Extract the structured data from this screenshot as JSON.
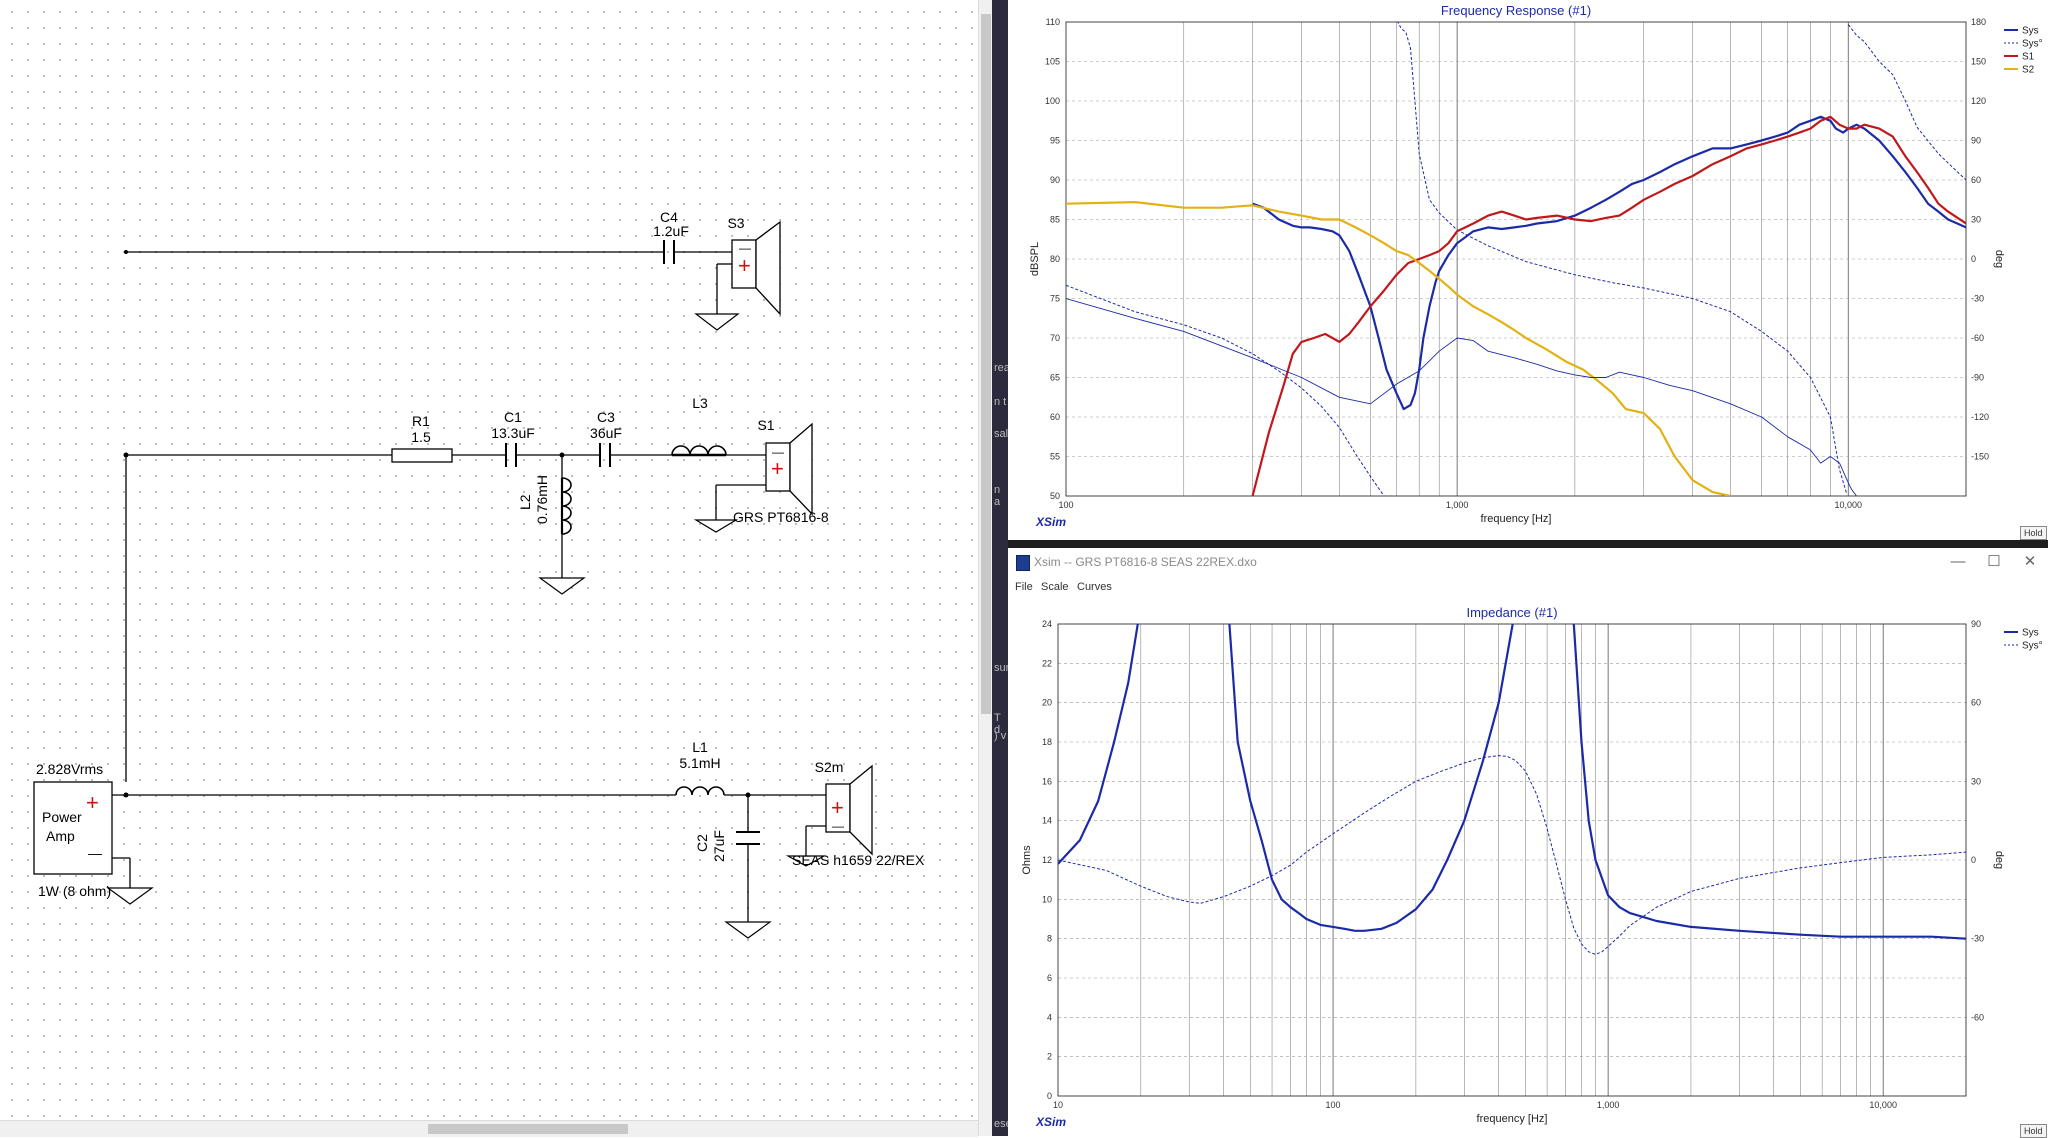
{
  "schematic": {
    "components": {
      "c4": {
        "name": "C4",
        "value": "1.2uF"
      },
      "s3": {
        "name": "S3"
      },
      "r1": {
        "name": "R1",
        "value": "1.5"
      },
      "c1": {
        "name": "C1",
        "value": "13.3uF"
      },
      "c3": {
        "name": "C3",
        "value": "36uF"
      },
      "l3": {
        "name": "L3"
      },
      "s1": {
        "name": "S1",
        "driver": "GRS PT6816-8"
      },
      "l2": {
        "name": "L2",
        "value": "0.76mH"
      },
      "l1": {
        "name": "L1",
        "value": "5.1mH"
      },
      "c2": {
        "name": "C2",
        "value": "27uF"
      },
      "s2m": {
        "name": "S2m",
        "driver": "SEAS h1659 22/REX"
      },
      "amp": {
        "voltage": "2.828Vrms",
        "line1": "Power",
        "line2": "Amp",
        "rating": "1W (8 ohm)"
      }
    },
    "plus_sign": "+",
    "minus_sign": "—"
  },
  "gap_fragments": [
    "rea",
    "n t",
    "sal",
    "n a",
    "sur",
    "T d",
    ") v",
    "ese"
  ],
  "fr_window": {
    "brand": "XSim",
    "hold_label": "Hold"
  },
  "imp_window": {
    "title": "Xsim -- GRS PT6816-8 SEAS 22REX.dxo",
    "menu": [
      "File",
      "Scale",
      "Curves"
    ],
    "brand": "XSim",
    "hold_label": "Hold",
    "minimize": "—",
    "maximize": "☐",
    "close": "✕"
  },
  "chart_data": [
    {
      "type": "line",
      "title": "Frequency Response (#1)",
      "xlabel": "frequency [Hz]",
      "ylabel": "dBSPL",
      "y2label": "deg",
      "xscale": "log",
      "xlim": [
        100,
        20000
      ],
      "ylim": [
        50,
        110
      ],
      "y2lim": [
        -180,
        180
      ],
      "xticks": [
        100,
        1000,
        10000
      ],
      "xtick_labels": [
        "100",
        "1,000",
        "10,000"
      ],
      "yticks": [
        50,
        55,
        60,
        65,
        70,
        75,
        80,
        85,
        90,
        95,
        100,
        105,
        110
      ],
      "y2ticks": [
        -150,
        -120,
        -90,
        -60,
        -30,
        0,
        30,
        60,
        90,
        120,
        150,
        180
      ],
      "grid": true,
      "legend_position": "top-right",
      "series": [
        {
          "name": "Sys",
          "color": "#1b2ba8",
          "width": 2.2,
          "dash": false,
          "axis": "y",
          "x": [
            300,
            320,
            350,
            380,
            400,
            420,
            450,
            480,
            500,
            530,
            560,
            600,
            630,
            660,
            700,
            730,
            760,
            780,
            800,
            820,
            850,
            880,
            900,
            950,
            1000,
            1100,
            1200,
            1300,
            1400,
            1500,
            1600,
            1800,
            2000,
            2200,
            2400,
            2600,
            2800,
            3000,
            3300,
            3600,
            4000,
            4500,
            5000,
            5500,
            6000,
            6500,
            7000,
            7500,
            8000,
            8500,
            9000,
            9300,
            9700,
            10000,
            10500,
            11000,
            12000,
            13000,
            14000,
            15000,
            16000,
            17000,
            18000,
            19000,
            20000
          ],
          "y": [
            87,
            86.5,
            85,
            84.2,
            84,
            84,
            83.8,
            83.5,
            83,
            81,
            78,
            74,
            70,
            66,
            63,
            61,
            61.5,
            63,
            66,
            70,
            74,
            77,
            78.5,
            80.5,
            82,
            83.5,
            84,
            83.8,
            84,
            84.2,
            84.5,
            84.8,
            85.5,
            86.5,
            87.5,
            88.5,
            89.5,
            90,
            91,
            92,
            93,
            94,
            94,
            94.5,
            95,
            95.5,
            96,
            97,
            97.5,
            98,
            97.5,
            96.5,
            96,
            96.5,
            97,
            96.5,
            95,
            93,
            91,
            89,
            87,
            86,
            85,
            84.5,
            84
          ]
        },
        {
          "name": "Sys°",
          "color": "#1b2ba8",
          "width": 1,
          "dash": true,
          "axis": "y2",
          "x": [
            100,
            150,
            200,
            250,
            300,
            350,
            400,
            450,
            500,
            550,
            600,
            650,
            680,
            700,
            705,
            720,
            740,
            760,
            780,
            800,
            850,
            900,
            1000,
            1200,
            1500,
            2000,
            2500,
            3000,
            4000,
            5000,
            6000,
            7000,
            8000,
            9000,
            9500,
            9900,
            10000,
            10500,
            11000,
            12000,
            13000,
            14000,
            15000,
            17000,
            20000
          ],
          "y": [
            -20,
            -40,
            -50,
            -60,
            -72,
            -85,
            -98,
            -112,
            -128,
            -148,
            -165,
            -180,
            -180,
            180,
            180,
            175,
            172,
            160,
            120,
            80,
            45,
            35,
            22,
            10,
            -2,
            -12,
            -18,
            -22,
            -30,
            -40,
            -55,
            -70,
            -90,
            -120,
            -160,
            -178,
            178,
            170,
            165,
            150,
            140,
            120,
            100,
            80,
            60
          ]
        },
        {
          "name": "S1",
          "color": "#c0181b",
          "width": 2.2,
          "dash": false,
          "axis": "y",
          "x": [
            300,
            330,
            360,
            380,
            400,
            430,
            460,
            480,
            500,
            530,
            560,
            600,
            650,
            700,
            750,
            800,
            850,
            900,
            950,
            1000,
            1100,
            1200,
            1300,
            1400,
            1500,
            1600,
            1800,
            2000,
            2200,
            2400,
            2600,
            2800,
            3000,
            3300,
            3600,
            4000,
            4500,
            5000,
            5500,
            6000,
            6500,
            7000,
            7500,
            8000,
            8500,
            9000,
            9500,
            10000,
            10500,
            11000,
            12000,
            13000,
            14000,
            15000,
            16000,
            17000,
            18000,
            20000
          ],
          "y": [
            50,
            58,
            64,
            68,
            69.5,
            70,
            70.5,
            70,
            69.5,
            70.5,
            72,
            74,
            76,
            78,
            79.5,
            80,
            80.5,
            81,
            82,
            83.5,
            84.5,
            85.5,
            86,
            85.5,
            85,
            85.2,
            85.5,
            85,
            84.8,
            85.2,
            85.5,
            86.5,
            87.5,
            88.5,
            89.5,
            90.5,
            92,
            93,
            94,
            94.5,
            95,
            95.5,
            96,
            96.5,
            97.5,
            98,
            97,
            96.5,
            96.5,
            97,
            96.5,
            95.5,
            93,
            91,
            89,
            87,
            86,
            84.5
          ]
        },
        {
          "name": "S2",
          "color": "#e3b112",
          "width": 2.2,
          "dash": false,
          "axis": "y",
          "x": [
            100,
            150,
            200,
            250,
            300,
            350,
            400,
            450,
            500,
            550,
            600,
            650,
            700,
            750,
            800,
            850,
            900,
            950,
            1000,
            1100,
            1200,
            1300,
            1400,
            1500,
            1700,
            1900,
            2100,
            2300,
            2500,
            2700,
            3000,
            3300,
            3600,
            4000,
            4500,
            5000
          ],
          "y": [
            87,
            87.2,
            86.5,
            86.5,
            86.8,
            86,
            85.5,
            85,
            85,
            84,
            83,
            82,
            81,
            80.5,
            79.5,
            78.5,
            77.5,
            76.5,
            75.5,
            74,
            73,
            72,
            71,
            70,
            68.5,
            67,
            66,
            64.5,
            63,
            61,
            60.5,
            58.5,
            55,
            52,
            50.5,
            50
          ]
        },
        {
          "name": "",
          "color": "#1b2ba8",
          "width": 0.9,
          "dash": false,
          "axis": "y2",
          "x": [
            100,
            150,
            200,
            300,
            400,
            500,
            600,
            700,
            800,
            900,
            1000,
            1100,
            1200,
            1400,
            1600,
            1800,
            2000,
            2200,
            2400,
            2600,
            2800,
            3000,
            3500,
            4000,
            5000,
            6000,
            7000,
            8000,
            8500,
            9000,
            9500,
            10000,
            10200,
            10500
          ],
          "y": [
            -30,
            -45,
            -55,
            -75,
            -90,
            -105,
            -110,
            -95,
            -85,
            -70,
            -60,
            -62,
            -70,
            -75,
            -80,
            -85,
            -88,
            -90,
            -90,
            -86,
            -88,
            -90,
            -96,
            -100,
            -110,
            -120,
            -135,
            -145,
            -155,
            -150,
            -155,
            -170,
            -175,
            -180
          ]
        }
      ]
    },
    {
      "type": "line",
      "title": "Impedance (#1)",
      "xlabel": "frequency [Hz]",
      "ylabel": "Ohms",
      "y2label": "deg",
      "xscale": "log",
      "xlim": [
        10,
        20000
      ],
      "ylim": [
        0,
        24
      ],
      "y2lim": [
        -90,
        90
      ],
      "xticks": [
        10,
        100,
        1000,
        10000
      ],
      "xtick_labels": [
        "10",
        "100",
        "1,000",
        "10,000"
      ],
      "yticks": [
        0,
        2,
        4,
        6,
        8,
        10,
        12,
        14,
        16,
        18,
        20,
        22,
        24
      ],
      "y2ticks": [
        -60,
        -30,
        0,
        30,
        60,
        90
      ],
      "grid": true,
      "legend_position": "top-right",
      "series": [
        {
          "name": "Sys",
          "color": "#1b2ba8",
          "width": 2.2,
          "dash": false,
          "axis": "y",
          "x": [
            10,
            12,
            14,
            16,
            18,
            19.5,
            20.5,
            22,
            25,
            30,
            35,
            40,
            42,
            45,
            50,
            55,
            60,
            65,
            70,
            75,
            80,
            90,
            100,
            110,
            120,
            130,
            150,
            170,
            200,
            230,
            260,
            300,
            350,
            400,
            450,
            500,
            520,
            540,
            700,
            720,
            750,
            800,
            850,
            900,
            1000,
            1100,
            1200,
            1500,
            2000,
            3000,
            5000,
            7000,
            10000,
            15000,
            20000
          ],
          "y": [
            11.8,
            13,
            15,
            18,
            21,
            24,
            28,
            28,
            28,
            28,
            28,
            28,
            24,
            18,
            15,
            13,
            11,
            10,
            9.6,
            9.3,
            9,
            8.7,
            8.6,
            8.5,
            8.4,
            8.4,
            8.5,
            8.8,
            9.5,
            10.5,
            12,
            14,
            17,
            20,
            24,
            28,
            28,
            28,
            28,
            28,
            24,
            18,
            14,
            12,
            10.2,
            9.6,
            9.3,
            8.9,
            8.6,
            8.4,
            8.2,
            8.1,
            8.1,
            8.1,
            8
          ]
        },
        {
          "name": "Sys°",
          "color": "#1b2ba8",
          "width": 1,
          "dash": true,
          "axis": "y2",
          "x": [
            10,
            15,
            20,
            25,
            30,
            33,
            40,
            50,
            60,
            70,
            80,
            100,
            130,
            160,
            200,
            250,
            300,
            350,
            400,
            430,
            460,
            500,
            550,
            600,
            650,
            700,
            750,
            800,
            850,
            900,
            950,
            1000,
            1100,
            1200,
            1500,
            2000,
            3000,
            5000,
            7000,
            10000,
            15000,
            20000
          ],
          "y": [
            0,
            -4,
            -10,
            -14,
            -16,
            -16.5,
            -14,
            -10,
            -6,
            -2,
            3,
            10,
            18,
            24,
            30,
            34,
            37,
            39,
            39.8,
            39.5,
            38,
            34,
            25,
            12,
            -2,
            -15,
            -26,
            -32,
            -35,
            -36,
            -35,
            -33,
            -29,
            -25,
            -18,
            -12,
            -7,
            -3,
            -1,
            1,
            2,
            3
          ]
        }
      ]
    }
  ]
}
